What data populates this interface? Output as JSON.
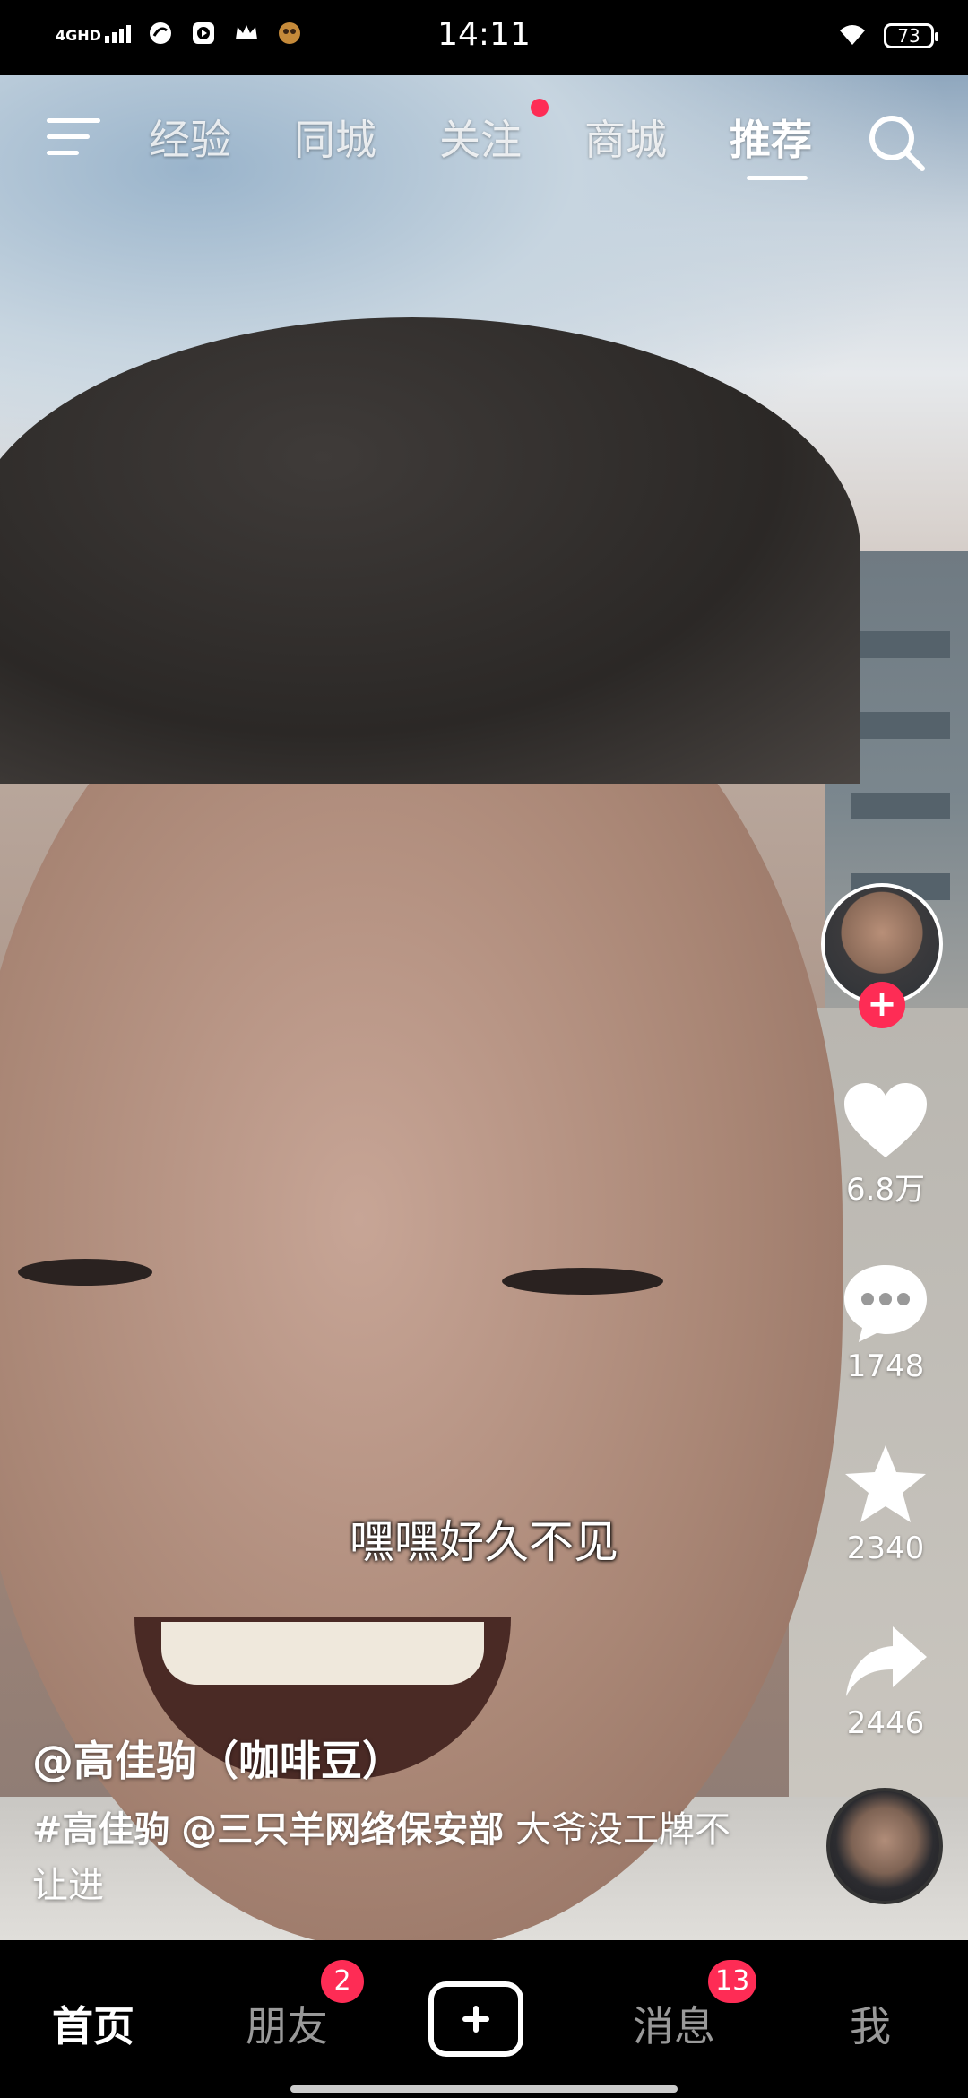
{
  "status_bar": {
    "network": "4GHD",
    "time": "14:11",
    "battery": "73",
    "icons": [
      "signal-icon",
      "app-icon",
      "video-icon",
      "crown-icon",
      "game-icon",
      "wifi-icon",
      "battery-icon"
    ]
  },
  "top_nav": {
    "tabs": [
      {
        "label": "经验"
      },
      {
        "label": "同城"
      },
      {
        "label": "关注"
      },
      {
        "label": "商城"
      },
      {
        "label": "推荐",
        "active": true
      }
    ],
    "icons": {
      "menu": "menu-icon",
      "search": "search-icon"
    }
  },
  "video": {
    "caption": "嘿嘿好久不见"
  },
  "right_rail": {
    "follow": "+",
    "likes": "6.8万",
    "comments": "1748",
    "favorites": "2340",
    "shares": "2446"
  },
  "post": {
    "author": "@高佳驹（咖啡豆）",
    "hashtag": "#高佳驹",
    "mention": "@三只羊网络保安部",
    "text": "大爷没工牌不让进"
  },
  "bottom_nav": {
    "items": [
      {
        "label": "首页",
        "active": true
      },
      {
        "label": "朋友",
        "badge": "2"
      },
      {
        "label": "消息",
        "badge": "13"
      },
      {
        "label": "我"
      }
    ]
  },
  "colors": {
    "accent": "#fe2c55",
    "background": "#000000"
  }
}
